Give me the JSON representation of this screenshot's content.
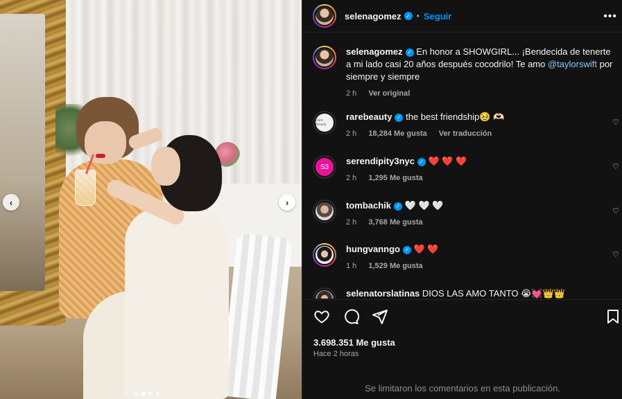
{
  "post": {
    "carousel": {
      "prev": "‹",
      "next": "›",
      "dots": 4,
      "active_dot": 1
    }
  },
  "header": {
    "username": "selenagomez",
    "separator": "•",
    "follow_label": "Seguir",
    "more": "•••"
  },
  "caption": {
    "username": "selenagomez",
    "text": "En honor a SHOWGIRL... ¡Bendecida de tenerte a mi lado casi 20 años después cocodrilo! Te amo ",
    "mention": "@taylorswift",
    "text_after": " por siempre y siempre",
    "time": "2 h",
    "see_original": "Ver original"
  },
  "comments": [
    {
      "username": "rarebeauty",
      "verified": true,
      "text": "the best friendship🥹 🫶🏻",
      "time": "2 h",
      "likes": "18,284 Me gusta",
      "extra": "Ver traducción",
      "avatar_text": "Rare Beauty"
    },
    {
      "username": "serendipity3nyc",
      "verified": true,
      "text": "❤️ ❤️ ❤️",
      "time": "2 h",
      "likes": "1,295 Me gusta",
      "avatar_text": "S3"
    },
    {
      "username": "tombachik",
      "verified": true,
      "text": "🤍 🤍 🤍",
      "time": "2 h",
      "likes": "3,768 Me gusta"
    },
    {
      "username": "hungvanngo",
      "verified": true,
      "text": "❤️ ❤️",
      "time": "1 h",
      "likes": "1,529 Me gusta"
    },
    {
      "username": "selenatorslatinas",
      "verified": false,
      "text": "DIOS LAS AMO TANTO 😭💓👑👑"
    }
  ],
  "actions": {
    "likes": "3.698.351 Me gusta",
    "posted": "Hace 2 horas",
    "limited": "Se limitaron los comentarios en esta publicación."
  },
  "colors": {
    "accent": "#0095f6",
    "bg": "#121212",
    "muted": "#a8a8a8"
  }
}
